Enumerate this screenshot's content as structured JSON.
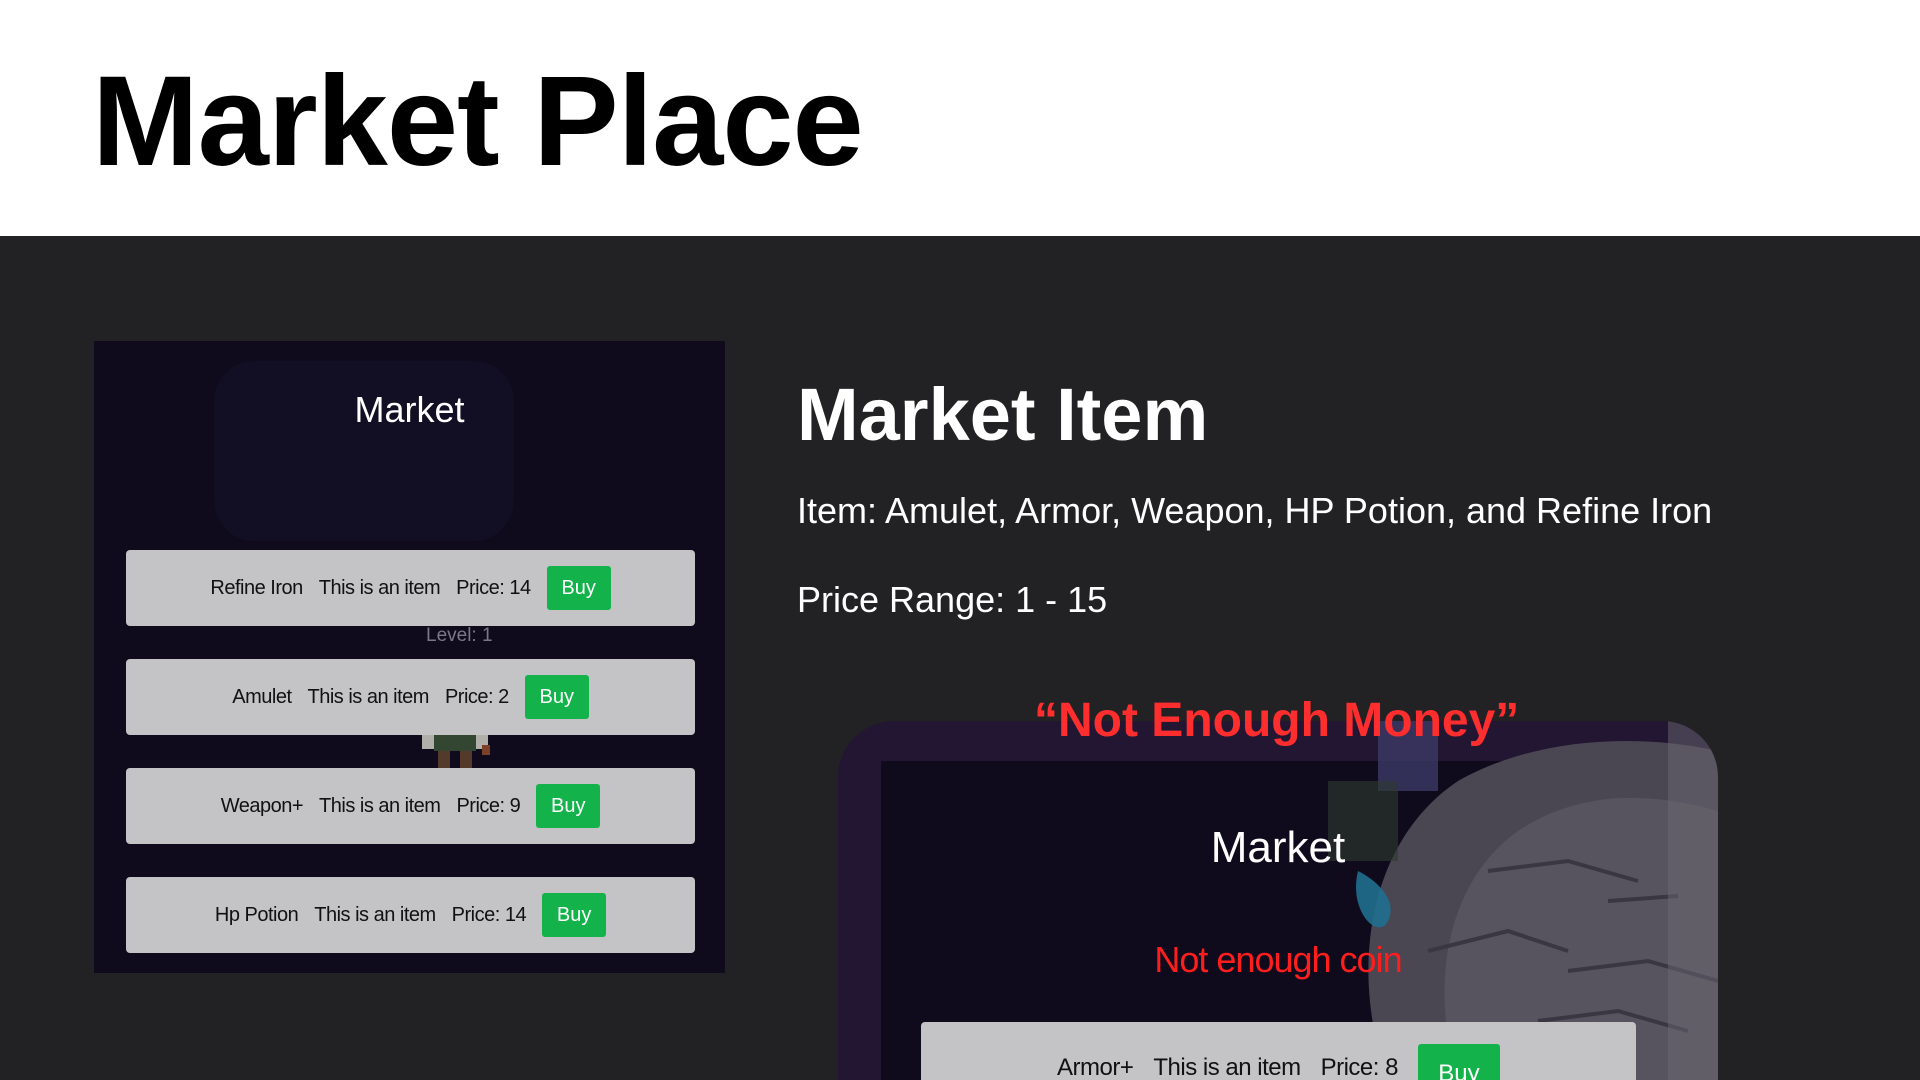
{
  "title": "Market Place",
  "market_panel": {
    "heading": "Market",
    "level": "Level: 1",
    "items": [
      {
        "name": "Refine Iron",
        "desc": "This is an item",
        "price": "Price: 14",
        "buy": "Buy"
      },
      {
        "name": "Amulet",
        "desc": "This is an item",
        "price": "Price: 2",
        "buy": "Buy"
      },
      {
        "name": "Weapon+",
        "desc": "This is an item",
        "price": "Price: 9",
        "buy": "Buy"
      },
      {
        "name": "Hp Potion",
        "desc": "This is an item",
        "price": "Price: 14",
        "buy": "Buy"
      }
    ]
  },
  "info": {
    "title": "Market Item",
    "items_line": "Item: Amulet, Armor, Weapon, HP Potion, and Refine Iron",
    "price_line": "Price Range: 1 - 15"
  },
  "error_caption": "“Not Enough Money”",
  "error_shot": {
    "heading": "Market",
    "error": "Not enough coin",
    "item": {
      "name": "Armor+",
      "desc": "This is an item",
      "price": "Price: 8",
      "buy": "Buy"
    }
  },
  "colors": {
    "buy_button": "#13b24a",
    "error_text": "#ff2e2e",
    "panel_bg": "#0f0b1c",
    "page_bg": "#222224"
  }
}
